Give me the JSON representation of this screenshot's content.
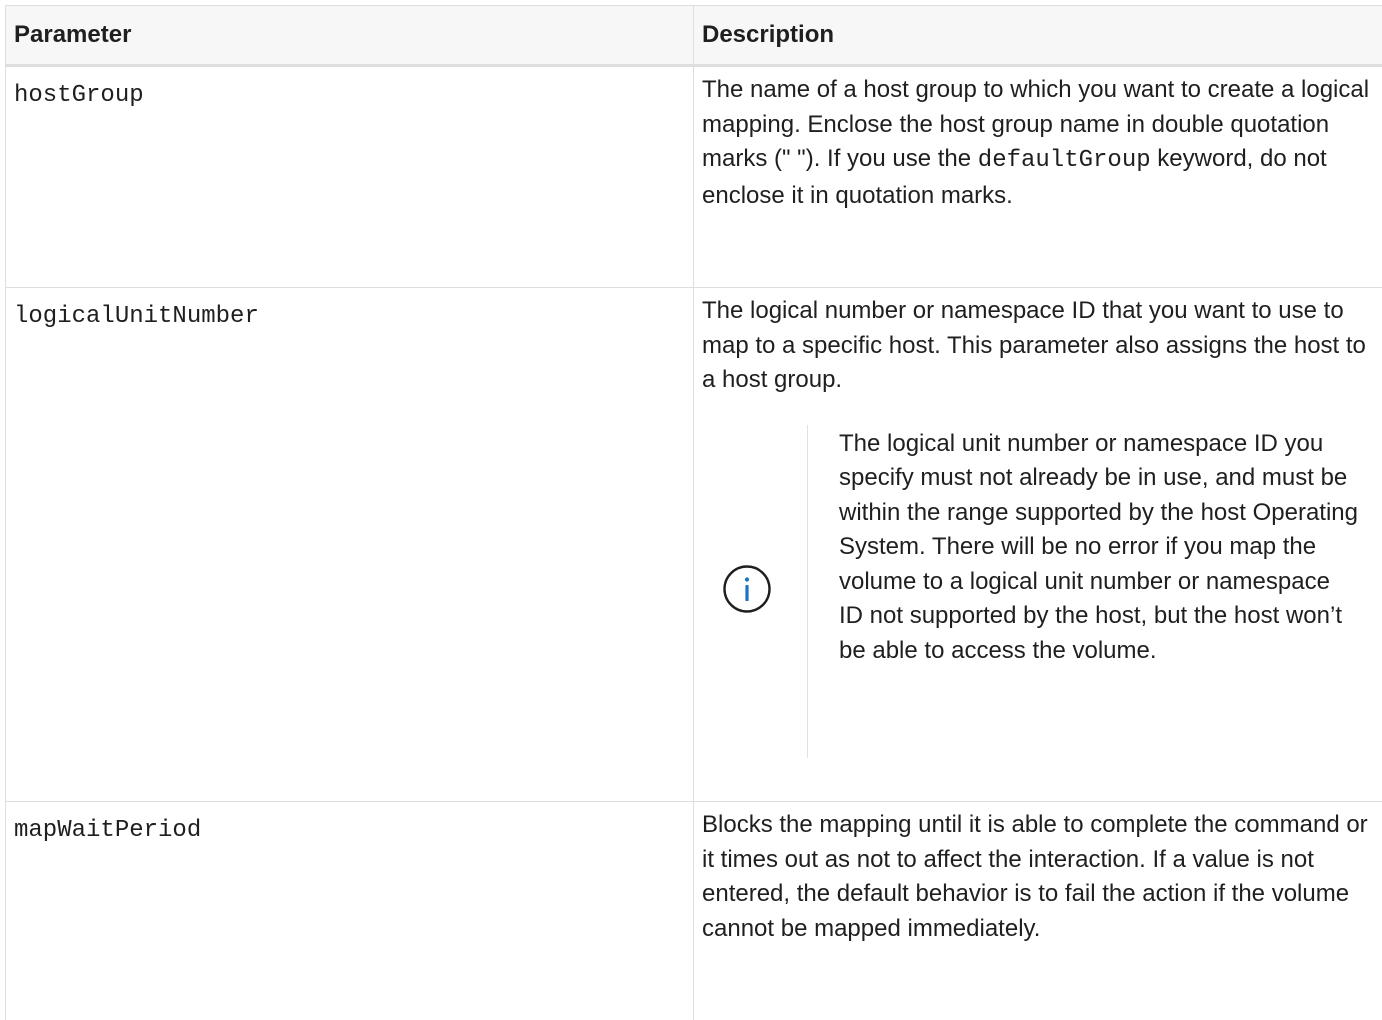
{
  "table": {
    "headers": {
      "parameter": "Parameter",
      "description": "Description"
    },
    "rows": [
      {
        "name": "hostGroup",
        "description_part1": "The name of a host group to which you want to create a logical mapping. Enclose the host group name in double quotation marks (\" \"). If you use the ",
        "description_code": "defaultGroup",
        "description_part2": " keyword, do not enclose it in quotation marks."
      },
      {
        "name": "logicalUnitNumber",
        "description": "The logical number or namespace ID that you want to use to map to a specific host. This parameter also assigns the host to a host group.",
        "note": {
          "icon": "info-icon",
          "text": "The logical unit number or namespace ID you specify must not already be in use, and must be within the range supported by the host Operating System. There will be no error if you map the volume to a logical unit number or namespace ID not supported by the host, but the host won’t be able to access the volume."
        }
      },
      {
        "name": "mapWaitPeriod",
        "description": "Blocks the mapping until it is able to complete the command or it times out as not to affect the interaction. If a value is not entered, the default behavior is to fail the action if the volume cannot be mapped immediately."
      }
    ]
  },
  "colors": {
    "text": "#1f1f1f",
    "header_background": "#f7f7f7",
    "border": "#dedede",
    "info_icon": "#1a73c5"
  }
}
